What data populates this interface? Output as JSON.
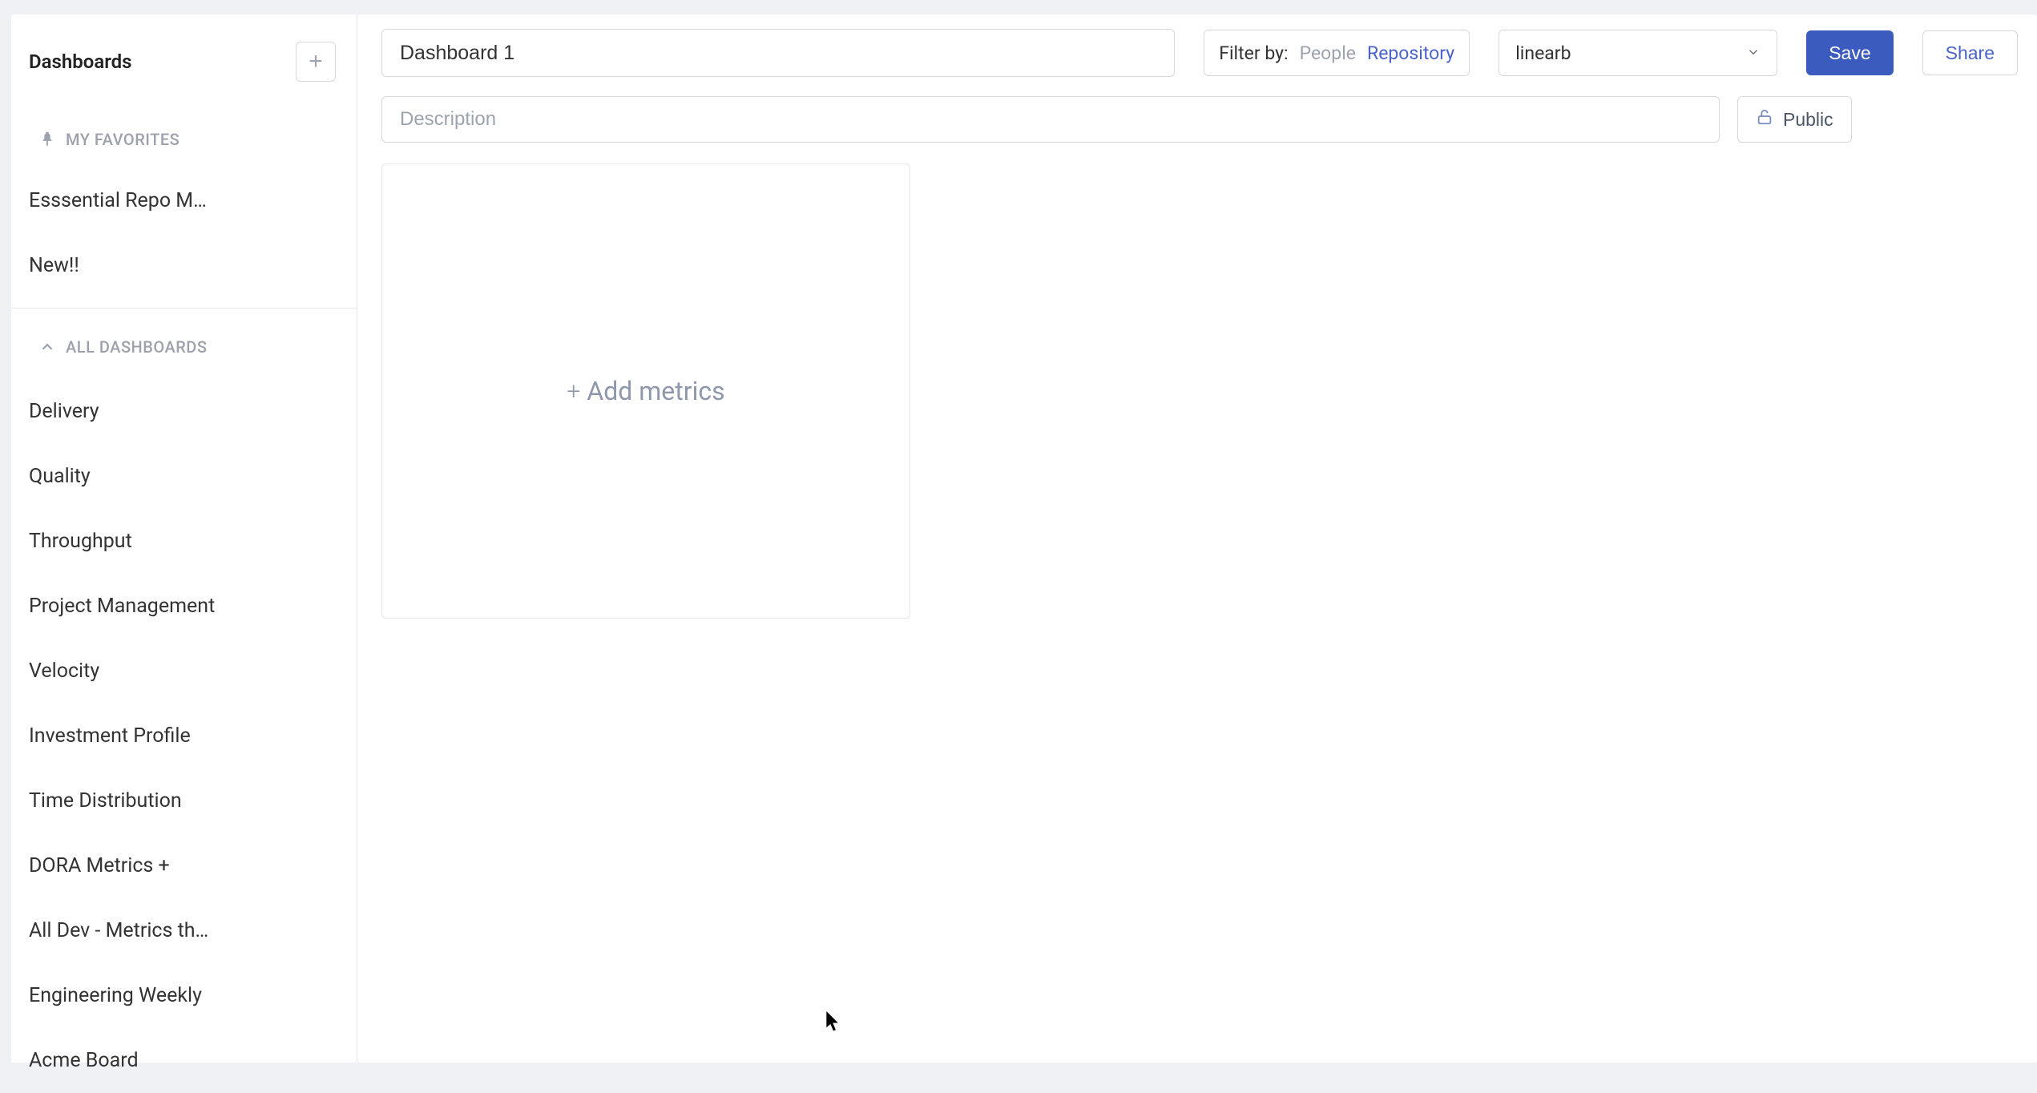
{
  "sidebar": {
    "title": "Dashboards",
    "favorites_label": "MY FAVORITES",
    "all_label": "ALL DASHBOARDS",
    "favorites": [
      "Esssential Repo M…",
      "New!!"
    ],
    "dashboards": [
      "Delivery",
      "Quality",
      "Throughput",
      "Project Management",
      "Velocity",
      "Investment Profile",
      "Time Distribution",
      "DORA Metrics +",
      "All Dev - Metrics th…",
      "Engineering Weekly",
      "Acme Board"
    ]
  },
  "header": {
    "title_value": "Dashboard 1",
    "filter_label": "Filter by:",
    "filter_people": "People",
    "filter_repo": "Repository",
    "dropdown_value": "linearb",
    "save_label": "Save",
    "share_label": "Share",
    "description_placeholder": "Description",
    "public_label": "Public"
  },
  "card": {
    "add_metrics_label": "Add metrics"
  }
}
